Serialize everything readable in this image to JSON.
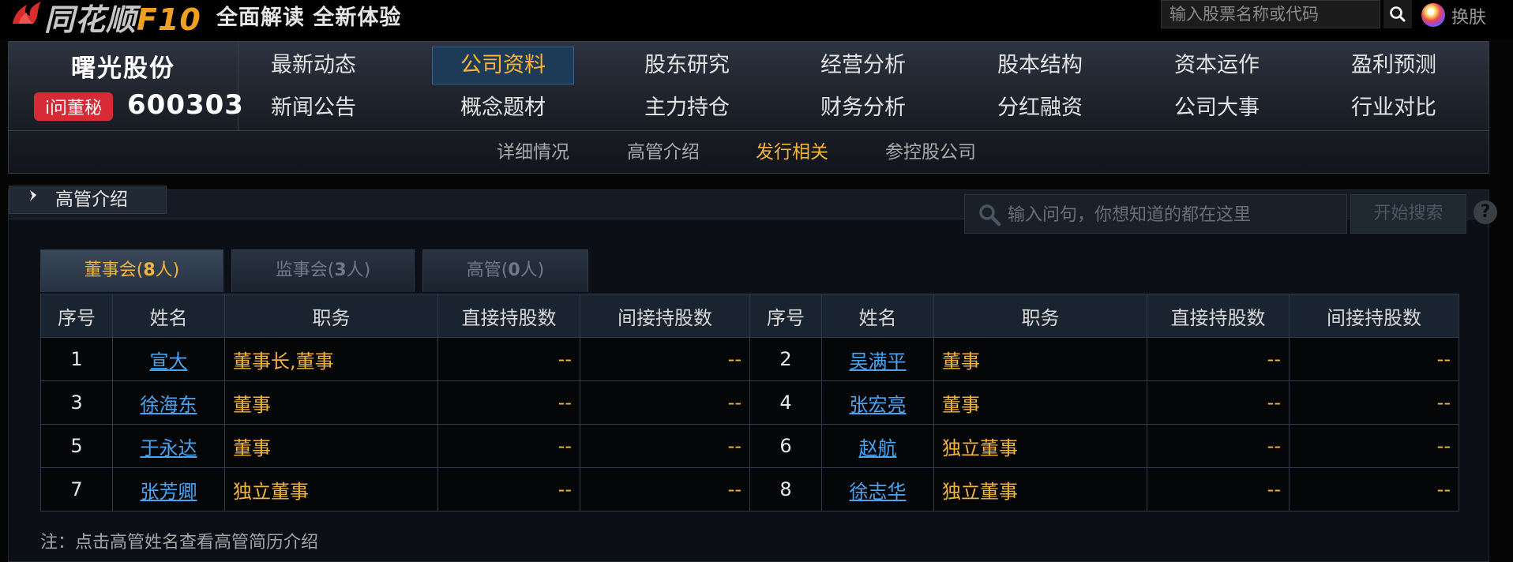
{
  "top": {
    "logo_text": "同花顺",
    "logo_f10": "F10",
    "slogan": "全面解读 全新体验",
    "search_placeholder": "输入股票名称或代码",
    "skin_label": "换肤"
  },
  "stock": {
    "name": "曙光股份",
    "ask_badge": "i问董秘",
    "code": "600303"
  },
  "nav": {
    "row1": [
      "最新动态",
      "公司资料",
      "股东研究",
      "经营分析",
      "股本结构",
      "资本运作",
      "盈利预测"
    ],
    "row2": [
      "新闻公告",
      "概念题材",
      "主力持仓",
      "财务分析",
      "分红融资",
      "公司大事",
      "行业对比"
    ],
    "active": "公司资料"
  },
  "subnav": {
    "items": [
      "详细情况",
      "高管介绍",
      "发行相关",
      "参控股公司"
    ],
    "active": "发行相关"
  },
  "section": {
    "title": "高管介绍",
    "question_placeholder": "输入问句，你想知道的都在这里",
    "search_button": "开始搜索",
    "help": "?"
  },
  "tabs": [
    {
      "label": "董事会(",
      "count": "8",
      "suffix": "人)",
      "active": true
    },
    {
      "label": "监事会(",
      "count": "3",
      "suffix": "人)",
      "active": false
    },
    {
      "label": "高管(",
      "count": "0",
      "suffix": "人)",
      "active": false
    }
  ],
  "table": {
    "headers": [
      "序号",
      "姓名",
      "职务",
      "直接持股数",
      "间接持股数",
      "序号",
      "姓名",
      "职务",
      "直接持股数",
      "间接持股数"
    ],
    "rows": [
      [
        {
          "idx": "1",
          "name": "宣大",
          "pos": "董事长,董事",
          "direct": "--",
          "indirect": "--"
        },
        {
          "idx": "2",
          "name": "吴满平",
          "pos": "董事",
          "direct": "--",
          "indirect": "--"
        }
      ],
      [
        {
          "idx": "3",
          "name": "徐海东",
          "pos": "董事",
          "direct": "--",
          "indirect": "--"
        },
        {
          "idx": "4",
          "name": "张宏亮",
          "pos": "董事",
          "direct": "--",
          "indirect": "--"
        }
      ],
      [
        {
          "idx": "5",
          "name": "于永达",
          "pos": "董事",
          "direct": "--",
          "indirect": "--"
        },
        {
          "idx": "6",
          "name": "赵航",
          "pos": "独立董事",
          "direct": "--",
          "indirect": "--"
        }
      ],
      [
        {
          "idx": "7",
          "name": "张芳卿",
          "pos": "独立董事",
          "direct": "--",
          "indirect": "--"
        },
        {
          "idx": "8",
          "name": "徐志华",
          "pos": "独立董事",
          "direct": "--",
          "indirect": "--"
        }
      ]
    ]
  },
  "note": "注：点击高管姓名查看高管简历介绍",
  "colors": {
    "accent": "#f2b43a",
    "link": "#4aa3ef",
    "badge": "#d62a36"
  }
}
